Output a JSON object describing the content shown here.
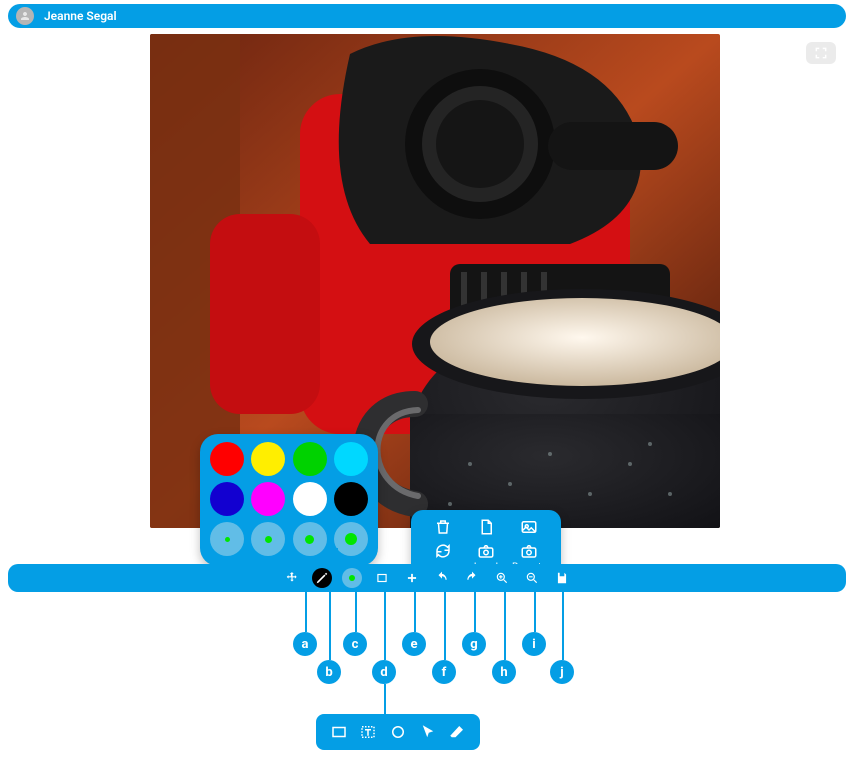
{
  "header": {
    "user_name": "Jeanne Segal"
  },
  "palette": {
    "colors_row1": [
      "#ff0000",
      "#ffee00",
      "#00d200",
      "#00d8ff"
    ],
    "colors_row2": [
      "#1200d0",
      "#ff00ff",
      "#ffffff",
      "#000000"
    ]
  },
  "file_popup": {
    "local_label": "Local",
    "remote_label": "Remote"
  },
  "labels": {
    "a": "a",
    "b": "b",
    "c": "c",
    "d": "d",
    "e": "e",
    "f": "f",
    "g": "g",
    "h": "h",
    "i": "i",
    "j": "j"
  },
  "tool_names": {
    "move": "move",
    "draw": "draw",
    "palette": "palette",
    "shape": "shape",
    "add": "add",
    "undo": "undo",
    "redo": "redo",
    "zoom_in": "zoom-in",
    "zoom_out": "zoom-out",
    "save": "save"
  }
}
